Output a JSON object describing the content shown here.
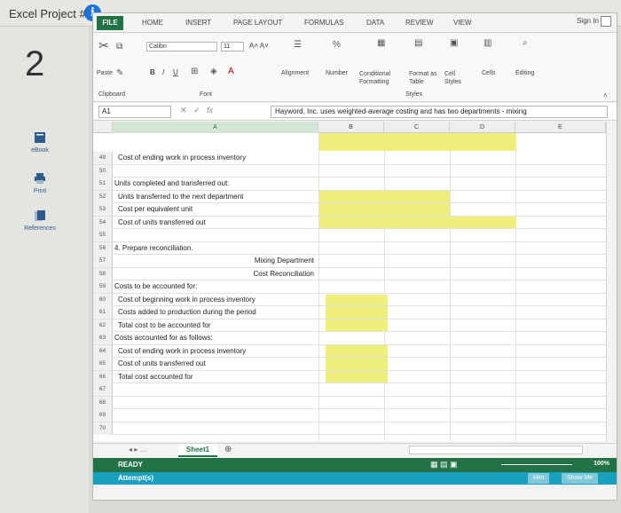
{
  "page": {
    "title": "Excel Project #1",
    "question_number": "2"
  },
  "side_tools": [
    {
      "label": "eBook",
      "icon": "book-icon"
    },
    {
      "label": "Print",
      "icon": "printer-icon"
    },
    {
      "label": "References",
      "icon": "references-icon"
    }
  ],
  "tabs": [
    "FILE",
    "HOME",
    "INSERT",
    "PAGE LAYOUT",
    "FORMULAS",
    "DATA",
    "REVIEW",
    "VIEW"
  ],
  "sign_in": "Sign In",
  "ribbon": {
    "paste": "Paste",
    "font_name": "Calibri",
    "font_size": "11",
    "bold": "B",
    "italic": "I",
    "underline": "U",
    "alignment": "Alignment",
    "number": "Number",
    "conditional_formatting": "Conditional Formatting",
    "format_as_table": "Format as Table",
    "cell_styles": "Cell Styles",
    "styles": "Styles",
    "cells": "Cells",
    "editing": "Editing",
    "clipboard": "Clipboard",
    "font": "Font"
  },
  "formula_bar": {
    "name_box": "A1",
    "fx": "fx",
    "content": "Hayword, Inc. uses weighted-average costing and has two departments - mixing"
  },
  "columns": [
    "A",
    "B",
    "C",
    "D",
    "E"
  ],
  "rows": [
    {
      "n": "49",
      "a": "Cost of ending work in process inventory"
    },
    {
      "n": "50",
      "a": ""
    },
    {
      "n": "51",
      "a": "Units completed and transferred out:"
    },
    {
      "n": "52",
      "a": "Units transferred to the next department"
    },
    {
      "n": "53",
      "a": "Cost per equivalent unit"
    },
    {
      "n": "54",
      "a": "Cost of units transferred out"
    },
    {
      "n": "55",
      "a": ""
    },
    {
      "n": "56",
      "a": "4. Prepare reconciliation."
    },
    {
      "n": "57",
      "a": "Mixing Department"
    },
    {
      "n": "58",
      "a": "Cost Reconciliation"
    },
    {
      "n": "59",
      "a": "Costs to be accounted for:"
    },
    {
      "n": "60",
      "a": "Cost of beginning work in process inventory"
    },
    {
      "n": "61",
      "a": "Costs added to production during the period"
    },
    {
      "n": "62",
      "a": "Total cost to be accounted for"
    },
    {
      "n": "63",
      "a": "Costs accounted for as follows:"
    },
    {
      "n": "64",
      "a": "Cost of ending work in process inventory"
    },
    {
      "n": "65",
      "a": "Cost of units transferred out"
    },
    {
      "n": "66",
      "a": "Total cost accounted for"
    },
    {
      "n": "67",
      "a": ""
    },
    {
      "n": "68",
      "a": ""
    },
    {
      "n": "69",
      "a": ""
    },
    {
      "n": "70",
      "a": ""
    }
  ],
  "sheet_tab": "Sheet1",
  "status": "READY",
  "zoom": "100%",
  "attempt": "Attempt(s)",
  "hint": "Hint",
  "show_me": "Show Me"
}
